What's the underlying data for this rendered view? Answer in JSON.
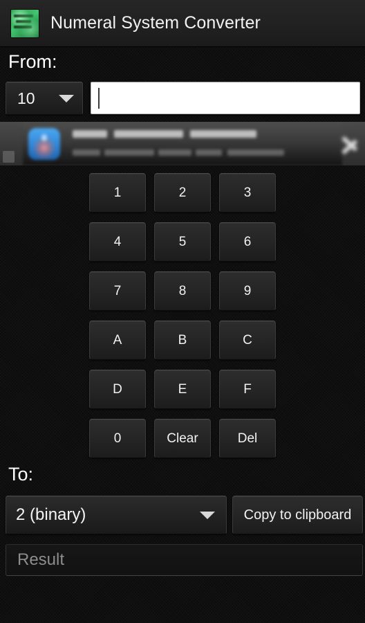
{
  "titlebar": {
    "app_icon_name": "app-logo-icon",
    "title": "Numeral System Converter"
  },
  "from_section": {
    "label": "From:",
    "base_spinner": {
      "value": "10",
      "caret_icon": "chevron-down-icon"
    },
    "input": {
      "value": "",
      "placeholder": ""
    }
  },
  "ad_banner": {
    "icon_name": "ad-app-icon",
    "headline": "",
    "subtext": "",
    "chevron_icon": "chevron-right-icon",
    "badge_name": "ad-info-badge"
  },
  "keypad": {
    "keys": [
      {
        "label": "1",
        "name": "key-1"
      },
      {
        "label": "2",
        "name": "key-2"
      },
      {
        "label": "3",
        "name": "key-3"
      },
      {
        "label": "4",
        "name": "key-4"
      },
      {
        "label": "5",
        "name": "key-5"
      },
      {
        "label": "6",
        "name": "key-6"
      },
      {
        "label": "7",
        "name": "key-7"
      },
      {
        "label": "8",
        "name": "key-8"
      },
      {
        "label": "9",
        "name": "key-9"
      },
      {
        "label": "A",
        "name": "key-a"
      },
      {
        "label": "B",
        "name": "key-b"
      },
      {
        "label": "C",
        "name": "key-c"
      },
      {
        "label": "D",
        "name": "key-d"
      },
      {
        "label": "E",
        "name": "key-e"
      },
      {
        "label": "F",
        "name": "key-f"
      },
      {
        "label": "0",
        "name": "key-0"
      },
      {
        "label": "Clear",
        "name": "key-clear"
      },
      {
        "label": "Del",
        "name": "key-del"
      }
    ]
  },
  "to_section": {
    "label": "To:",
    "base_spinner": {
      "value": "2 (binary)",
      "caret_icon": "chevron-down-icon"
    },
    "copy_button": "Copy to clipboard"
  },
  "result": {
    "value": "",
    "placeholder": "Result"
  },
  "colors": {
    "background": "#0c0c0c",
    "titlebar": "#222222",
    "button_face": "#262626",
    "text_primary": "#f2f2f2",
    "placeholder": "#8d8d8d",
    "input_background": "#ffffff",
    "icon_green": "#45c672",
    "ad_icon_blue": "#2e86d8"
  }
}
